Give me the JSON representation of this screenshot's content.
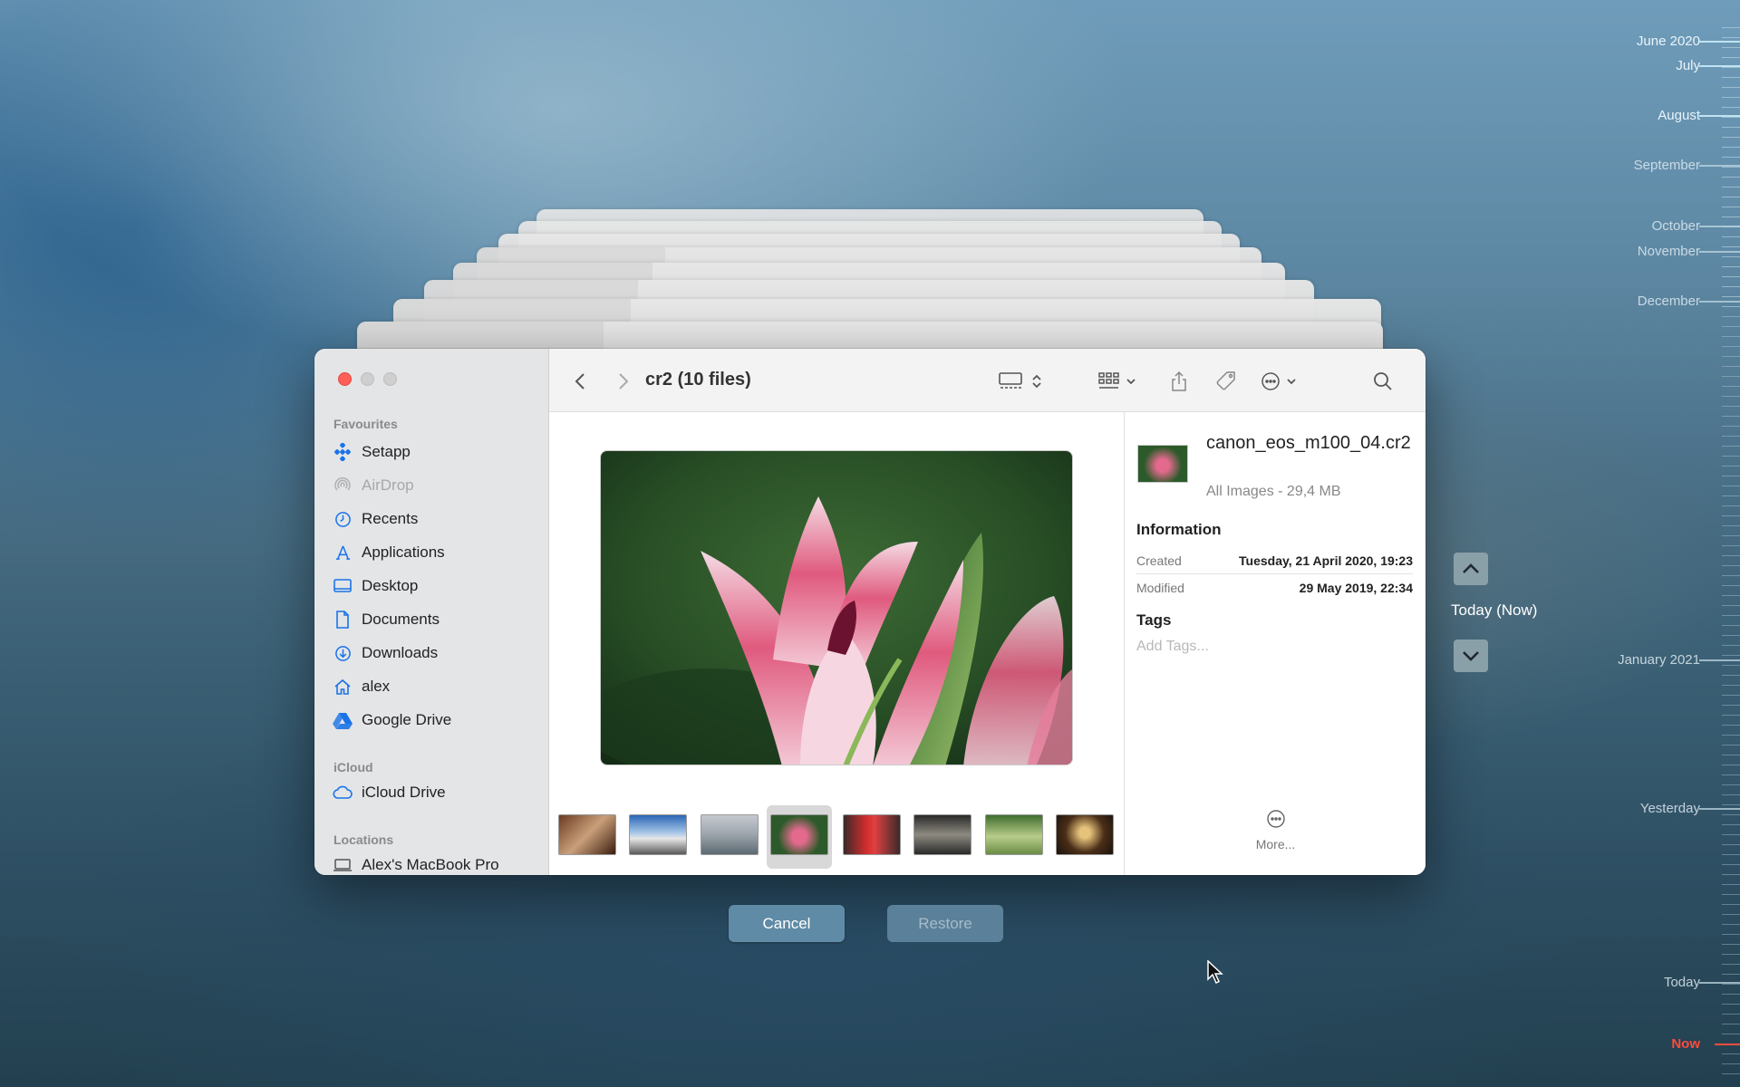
{
  "window": {
    "title": "cr2 (10 files)"
  },
  "sidebar": {
    "sections": {
      "favourites": "Favourites",
      "icloud": "iCloud",
      "locations": "Locations"
    },
    "items": [
      {
        "label": "Setapp",
        "icon": "setapp-icon"
      },
      {
        "label": "AirDrop",
        "icon": "airdrop-icon"
      },
      {
        "label": "Recents",
        "icon": "clock-icon"
      },
      {
        "label": "Applications",
        "icon": "applications-icon"
      },
      {
        "label": "Desktop",
        "icon": "desktop-icon"
      },
      {
        "label": "Documents",
        "icon": "document-icon"
      },
      {
        "label": "Downloads",
        "icon": "download-icon"
      },
      {
        "label": "alex",
        "icon": "home-icon"
      },
      {
        "label": "Google Drive",
        "icon": "google-drive-icon"
      }
    ],
    "icloud_items": [
      {
        "label": "iCloud Drive",
        "icon": "cloud-icon"
      }
    ],
    "location_items": [
      {
        "label": "Alex's MacBook Pro",
        "icon": "laptop-icon"
      }
    ]
  },
  "info": {
    "filename": "canon_eos_m100_04.cr2",
    "kind": "All Images - 29,4 MB",
    "information_heading": "Information",
    "created_label": "Created",
    "created_value": "Tuesday, 21 April 2020, 19:23",
    "modified_label": "Modified",
    "modified_value": "29 May 2019, 22:34",
    "tags_heading": "Tags",
    "tags_placeholder": "Add Tags...",
    "more_label": "More..."
  },
  "buttons": {
    "cancel": "Cancel",
    "restore": "Restore"
  },
  "time_machine": {
    "current": "Today (Now)",
    "timeline": [
      {
        "label": "June 2020"
      },
      {
        "label": "July"
      },
      {
        "label": "August"
      },
      {
        "label": "September"
      },
      {
        "label": "October"
      },
      {
        "label": "November"
      },
      {
        "label": "December"
      },
      {
        "label": "January 2021"
      },
      {
        "label": "Yesterday"
      },
      {
        "label": "Today"
      },
      {
        "label": "Now"
      }
    ]
  },
  "colors": {
    "accent": "#1a73e8",
    "now": "#ff4b3e",
    "close": "#fe5f57"
  }
}
